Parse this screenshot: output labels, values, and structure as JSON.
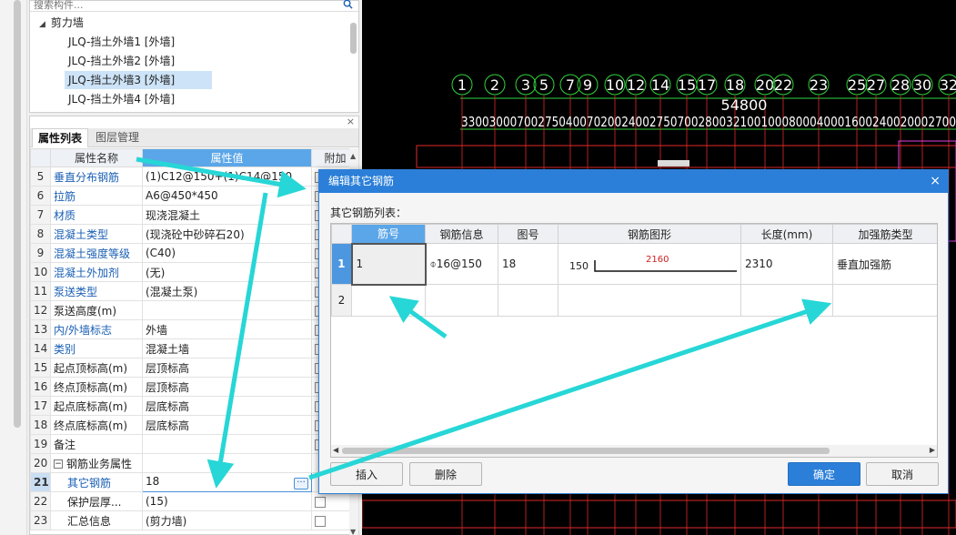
{
  "search": {
    "placeholder": "搜索构件..."
  },
  "tree": {
    "root": "剪力墙",
    "items": [
      "JLQ-挡土外墙1 [外墙]",
      "JLQ-挡土外墙2 [外墙]",
      "JLQ-挡土外墙3 [外墙]",
      "JLQ-挡土外墙4 [外墙]"
    ],
    "selected_index": 2
  },
  "prop_panel": {
    "close": "×",
    "tabs": [
      "属性列表",
      "图层管理"
    ],
    "headers": [
      "",
      "属性名称",
      "属性值",
      "附加"
    ],
    "rows": [
      {
        "n": "5",
        "name": "垂直分布钢筋",
        "value": "(1)C12@150+(1)C14@150",
        "blue": true,
        "check": true
      },
      {
        "n": "6",
        "name": "拉筋",
        "value": "A6@450*450",
        "blue": true,
        "check": true
      },
      {
        "n": "7",
        "name": "材质",
        "value": "现浇混凝土",
        "blue": true,
        "check": true
      },
      {
        "n": "8",
        "name": "混凝土类型",
        "value": "(现浇砼中砂碎石20)",
        "blue": true,
        "check": true
      },
      {
        "n": "9",
        "name": "混凝土强度等级",
        "value": "(C40)",
        "blue": true,
        "check": true
      },
      {
        "n": "10",
        "name": "混凝土外加剂",
        "value": "(无)",
        "blue": true,
        "check": true
      },
      {
        "n": "11",
        "name": "泵送类型",
        "value": "(混凝土泵)",
        "blue": true,
        "check": true
      },
      {
        "n": "12",
        "name": "泵送高度(m)",
        "value": "",
        "blue": false,
        "check": true
      },
      {
        "n": "13",
        "name": "内/外墙标志",
        "value": "外墙",
        "blue": true,
        "check": true
      },
      {
        "n": "14",
        "name": "类别",
        "value": "混凝土墙",
        "blue": true,
        "check": true
      },
      {
        "n": "15",
        "name": "起点顶标高(m)",
        "value": "层顶标高",
        "blue": false,
        "check": true
      },
      {
        "n": "16",
        "name": "终点顶标高(m)",
        "value": "层顶标高",
        "blue": false,
        "check": true
      },
      {
        "n": "17",
        "name": "起点底标高(m)",
        "value": "层底标高",
        "blue": false,
        "check": true
      },
      {
        "n": "18",
        "name": "终点底标高(m)",
        "value": "层底标高",
        "blue": false,
        "check": true
      },
      {
        "n": "19",
        "name": "备注",
        "value": "",
        "blue": false,
        "check": true
      },
      {
        "n": "20",
        "name": "钢筋业务属性",
        "value": "",
        "blue": false,
        "check": false,
        "group": true
      },
      {
        "n": "21",
        "name": "其它钢筋",
        "value": "18",
        "blue": true,
        "check": false,
        "selected": true,
        "indent": true
      },
      {
        "n": "22",
        "name": "保护层厚...",
        "value": "(15)",
        "blue": false,
        "check": true,
        "indent": true
      },
      {
        "n": "23",
        "name": "汇总信息",
        "value": "(剪力墙)",
        "blue": false,
        "check": true,
        "indent": true
      }
    ]
  },
  "cad": {
    "axis_labels": [
      "1",
      "2",
      "3",
      "5",
      "7",
      "9",
      "10",
      "12",
      "14",
      "15",
      "17",
      "18",
      "20",
      "22",
      "23",
      "25",
      "27",
      "28",
      "30",
      "32"
    ],
    "total_dimension": "54800",
    "segment_dimensions": "33003000700275040070200240027507002800321001000800040001600240020002700"
  },
  "dialog": {
    "title": "编辑其它钢筋",
    "close": "×",
    "list_label": "其它钢筋列表：",
    "headers": [
      "",
      "筋号",
      "钢筋信息",
      "图号",
      "钢筋图形",
      "长度(mm)",
      "加强筋类型"
    ],
    "rows": [
      {
        "n": "1",
        "bar_no": "1",
        "info": "⌽16@150",
        "fig_no": "18",
        "shape_left": "150",
        "shape_mid": "2160",
        "length": "2310",
        "type": "垂直加强筋"
      },
      {
        "n": "2",
        "bar_no": "",
        "info": "",
        "fig_no": "",
        "shape_left": "",
        "shape_mid": "",
        "length": "",
        "type": ""
      }
    ],
    "buttons": {
      "insert": "插入",
      "delete": "删除",
      "ok": "确定",
      "cancel": "取消"
    }
  },
  "colors": {
    "accent": "#2b7fd8",
    "header_blue": "#5ba6e8",
    "arrow": "#27d6d6",
    "cad_green": "#2fd43a",
    "cad_red": "#e22a2a"
  }
}
